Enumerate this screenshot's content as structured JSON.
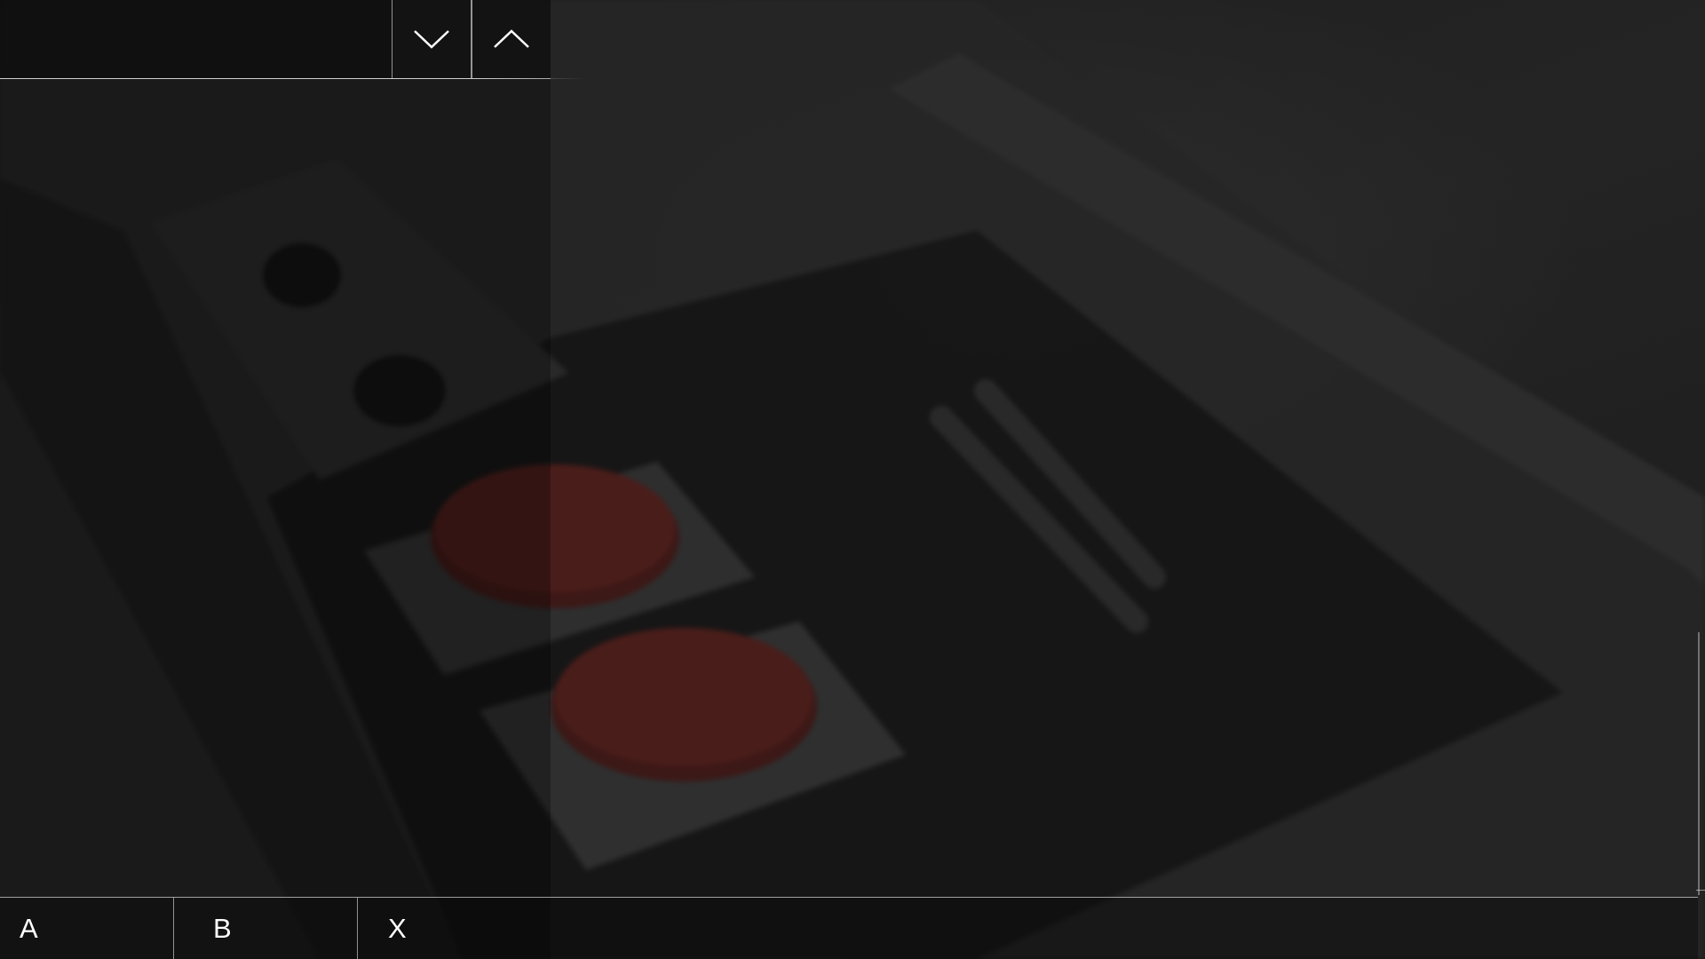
{
  "background": {
    "image": "nes-controller-photo",
    "tint": "#1c1c1c"
  },
  "top_bar": {
    "down_icon": "chevron-down-icon",
    "up_icon": "chevron-up-icon"
  },
  "bottom_tabs": [
    {
      "label": "A"
    },
    {
      "label": "B"
    },
    {
      "label": "X"
    }
  ],
  "colors": {
    "divider": "#ffffff",
    "text": "#ffffff",
    "button_red": "#5a1f1c"
  }
}
